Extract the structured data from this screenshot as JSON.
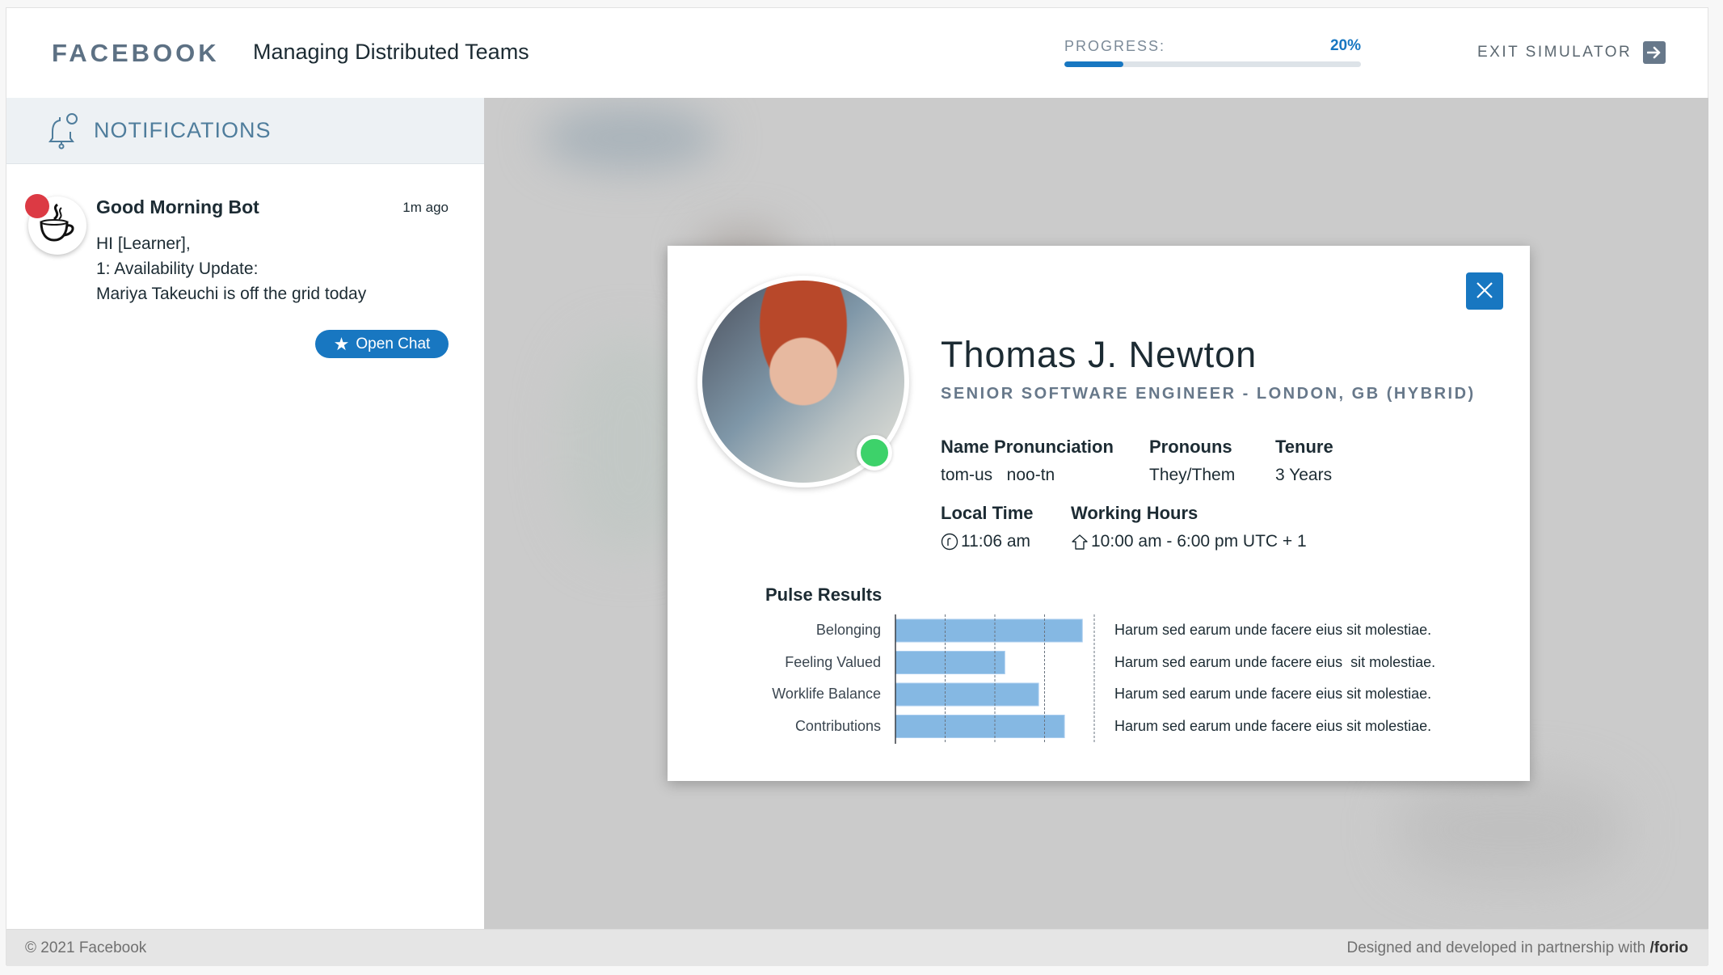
{
  "header": {
    "brand": "FACEBOOK",
    "title": "Managing Distributed Teams",
    "progress_label": "PROGRESS:",
    "progress_text": "20%",
    "progress_percent": 20,
    "exit_label": "EXIT SIMULATOR",
    "exit_icon": "arrow-right-icon"
  },
  "sidebar": {
    "title": "NOTIFICATIONS",
    "title_icon": "bell-icon",
    "notifications": [
      {
        "sender": "Good Morning Bot",
        "avatar_icon": "coffee-cup-icon",
        "unread": true,
        "time": "1m ago",
        "lines": [
          "HI [Learner],",
          "1: Availability Update:",
          "Mariya  Takeuchi is off the grid today"
        ],
        "action_label": "Open Chat",
        "action_icon": "star-icon"
      }
    ]
  },
  "profile": {
    "name": "Thomas J. Newton",
    "role": "SENIOR SOFTWARE ENGINEER - LONDON, GB (HYBRID)",
    "status": "online",
    "fields": {
      "pronunciation": {
        "label": "Name Pronunciation",
        "value": "tom-us   noo-tn"
      },
      "pronouns": {
        "label": "Pronouns",
        "value": "They/Them"
      },
      "tenure": {
        "label": "Tenure",
        "value": "3 Years"
      },
      "local_time": {
        "label": "Local Time",
        "value": "11:06 am",
        "icon": "clock-icon"
      },
      "working_hours": {
        "label": "Working Hours",
        "value": "10:00 am - 6:00 pm UTC + 1",
        "icon": "home-icon"
      }
    },
    "close_icon": "close-icon"
  },
  "chart_data": {
    "type": "bar",
    "orientation": "horizontal",
    "title": "Pulse Results",
    "categories": [
      "Belonging",
      "Feeling Valued",
      "Worklife Balance",
      "Contributions"
    ],
    "values": [
      94,
      55,
      72,
      85
    ],
    "xlim": [
      0,
      100
    ],
    "gridlines": [
      25,
      50,
      75,
      100
    ],
    "grid": true,
    "color": "#85b8e3",
    "descriptions": [
      "Harum sed earum unde facere eius sit molestiae.",
      "Harum sed earum unde facere eius  sit molestiae.",
      "Harum sed earum unde facere eius sit molestiae.",
      "Harum sed earum unde facere eius sit molestiae."
    ]
  },
  "footer": {
    "copyright": "© 2021 Facebook",
    "credit_prefix": "Designed and developed in partnership with ",
    "credit_brand": "/forio"
  }
}
